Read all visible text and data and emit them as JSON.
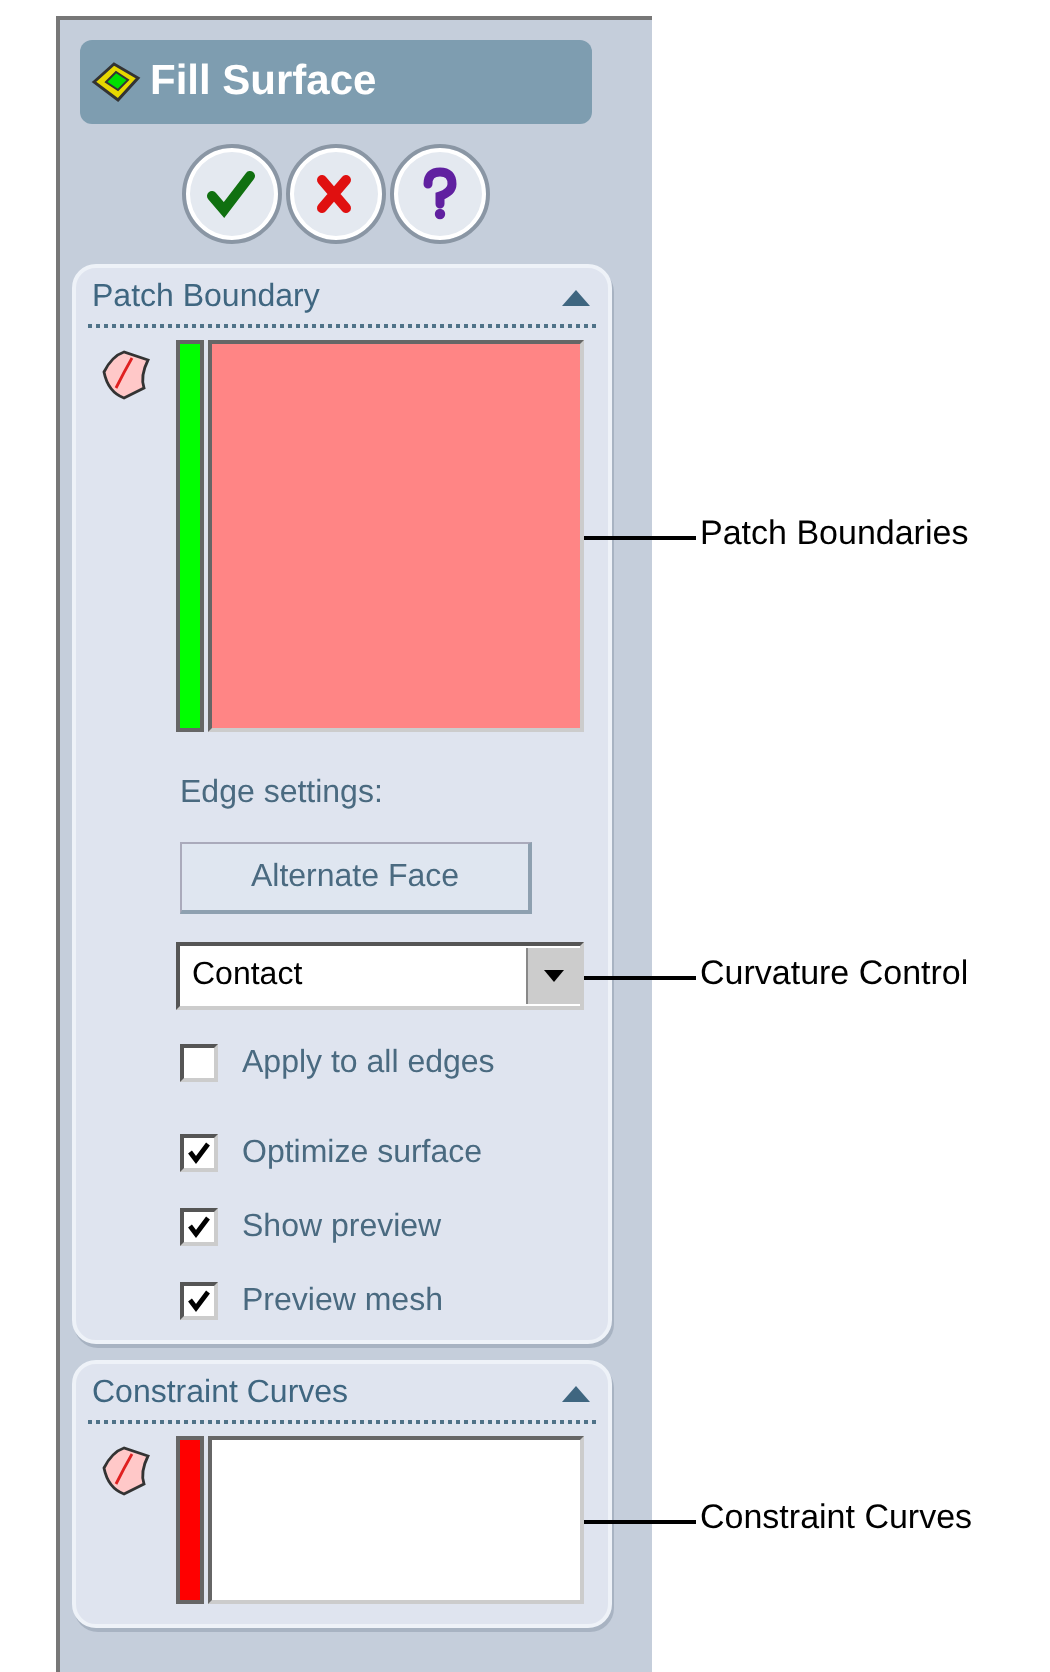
{
  "title": "Fill Surface",
  "buttons": [
    {
      "kind": "ok"
    },
    {
      "kind": "cancel"
    },
    {
      "kind": "help"
    }
  ],
  "groups": [
    {
      "title": "Patch Boundary",
      "expanded": true,
      "selection": {
        "color": "#00ff00",
        "filled": true,
        "callout": "Patch Boundaries"
      },
      "edge_label": "Edge settings:",
      "button": "Alternate Face",
      "dropdown": "Contact",
      "dropdown_callout": "Curvature Control",
      "checkboxes": [
        {
          "label": "Apply to all edges",
          "checked": false
        },
        {
          "label": "Optimize surface",
          "checked": true
        },
        {
          "label": "Show preview",
          "checked": true
        },
        {
          "label": "Preview mesh",
          "checked": true
        }
      ]
    },
    {
      "title": "Constraint Curves",
      "expanded": true,
      "selection": {
        "color": "#ff0000",
        "filled": false,
        "callout": "Constraint Curves"
      }
    }
  ]
}
